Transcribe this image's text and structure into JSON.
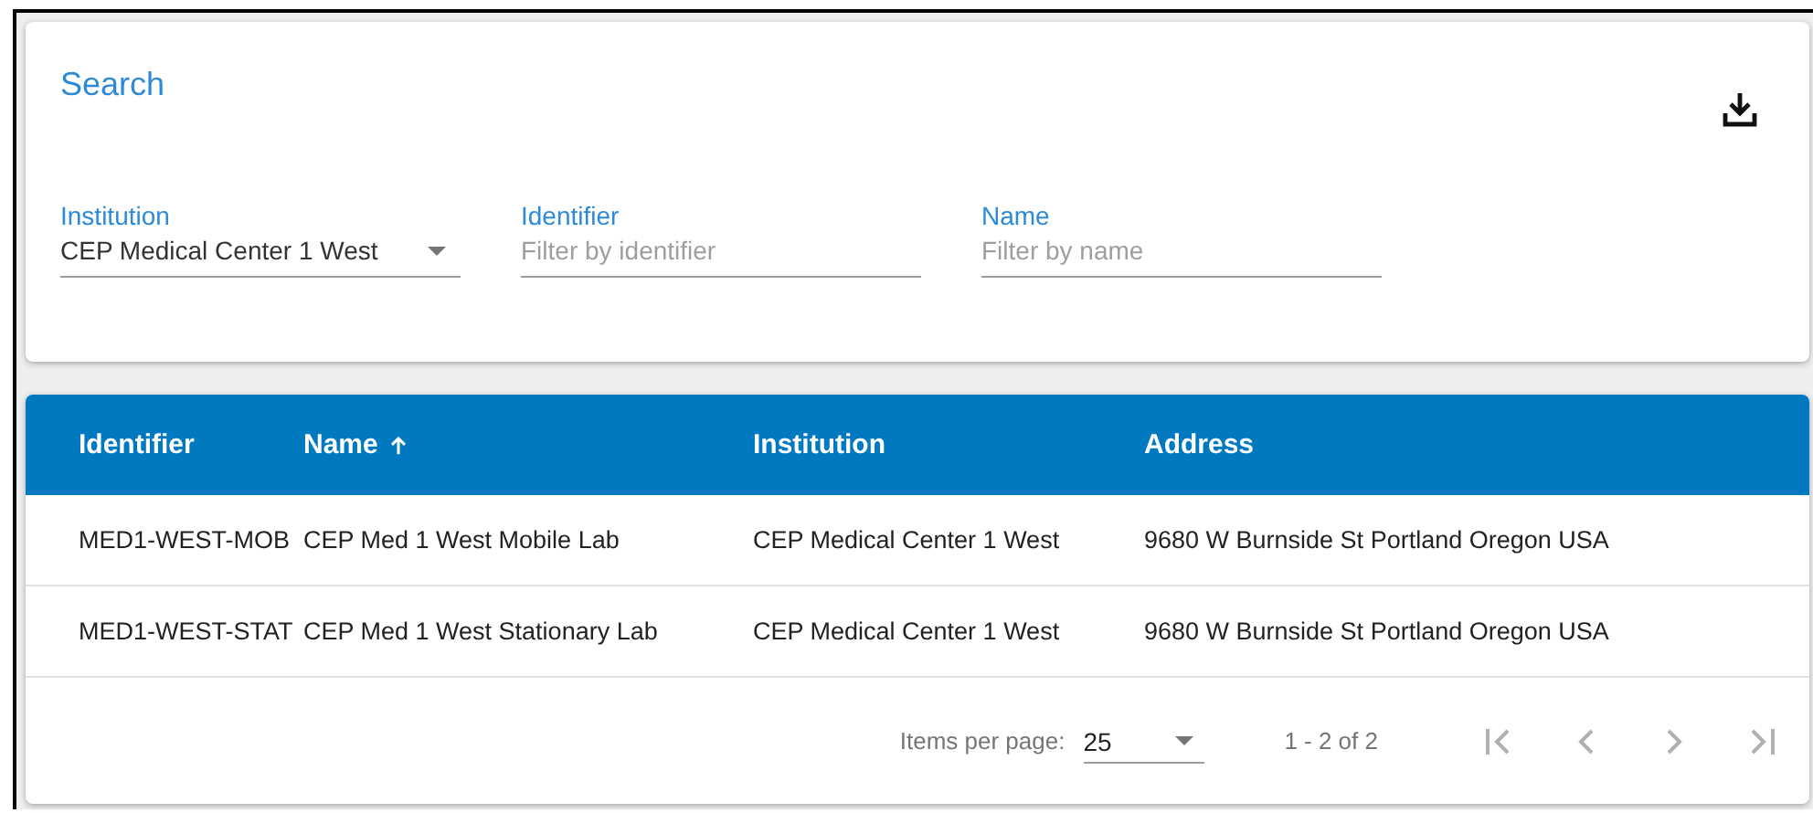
{
  "search": {
    "title": "Search",
    "fields": [
      {
        "kind": "select",
        "label": "Institution",
        "value": "CEP Medical Center 1 West"
      },
      {
        "kind": "text",
        "label": "Identifier",
        "placeholder": "Filter by identifier"
      },
      {
        "kind": "text",
        "label": "Name",
        "placeholder": "Filter by name"
      }
    ]
  },
  "table": {
    "columns": [
      {
        "label": "Identifier",
        "sorted": false
      },
      {
        "label": "Name",
        "sorted": true
      },
      {
        "label": "Institution",
        "sorted": false
      },
      {
        "label": "Address",
        "sorted": false
      }
    ],
    "rows": [
      [
        "MED1-WEST-MOB",
        "CEP Med 1 West Mobile Lab",
        "CEP Medical Center 1 West",
        "9680 W Burnside St Portland Oregon USA"
      ],
      [
        "MED1-WEST-STAT",
        "CEP Med 1 West Stationary Lab",
        "CEP Medical Center 1 West",
        "9680 W Burnside St Portland Oregon USA"
      ]
    ]
  },
  "paginator": {
    "items_label": "Items per page:",
    "page_size": "25",
    "range": "1 - 2 of 2"
  }
}
